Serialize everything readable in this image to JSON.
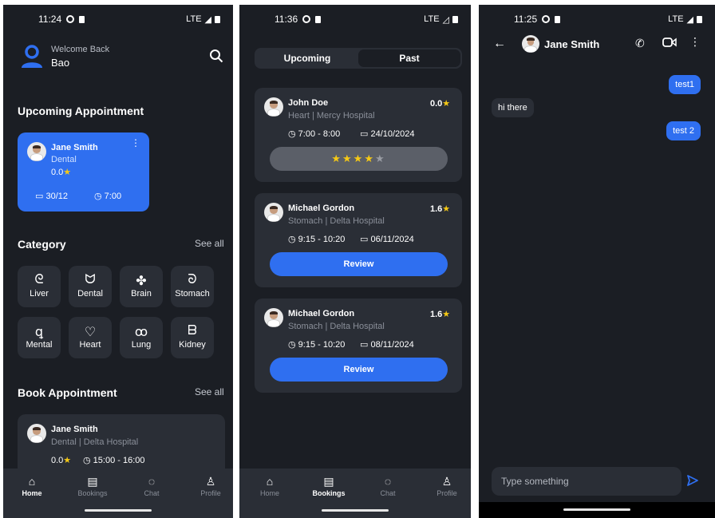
{
  "home": {
    "status": {
      "time": "11:24",
      "network": "LTE"
    },
    "welcome": "Welcome Back",
    "user_name": "Bao",
    "upcoming_title": "Upcoming Appointment",
    "upcoming": {
      "doctor": "Jane Smith",
      "specialty": "Dental",
      "rating": "0.0",
      "date": "30/12",
      "time": "7:00"
    },
    "category_title": "Category",
    "see_all": "See all",
    "categories": [
      "Liver",
      "Dental",
      "Brain",
      "Stomach",
      "Mental",
      "Heart",
      "Lung",
      "Kidney"
    ],
    "book_title": "Book Appointment",
    "book": {
      "doctor": "Jane Smith",
      "detail": "Dental | Delta Hospital",
      "rating": "0.0",
      "time": "15:00 - 16:00"
    },
    "nav": [
      "Home",
      "Bookings",
      "Chat",
      "Profile"
    ]
  },
  "bookings": {
    "status": {
      "time": "11:36",
      "network": "LTE"
    },
    "tabs": [
      "Upcoming",
      "Past"
    ],
    "cards": [
      {
        "doctor": "John Doe",
        "detail": "Heart | Mercy Hospital",
        "rating": "0.0",
        "time": "7:00 - 8:00",
        "date": "24/10/2024",
        "stars": 4
      },
      {
        "doctor": "Michael Gordon",
        "detail": "Stomach | Delta Hospital",
        "rating": "1.6",
        "time": "9:15 - 10:20",
        "date": "06/11/2024",
        "button": "Review"
      },
      {
        "doctor": "Michael Gordon",
        "detail": "Stomach | Delta Hospital",
        "rating": "1.6",
        "time": "9:15 - 10:20",
        "date": "08/11/2024",
        "button": "Review"
      }
    ],
    "nav": [
      "Home",
      "Bookings",
      "Chat",
      "Profile"
    ]
  },
  "chat": {
    "status": {
      "time": "11:25",
      "network": "LTE"
    },
    "contact": "Jane Smith",
    "messages": [
      {
        "from": "me",
        "text": "test1"
      },
      {
        "from": "them",
        "text": "hi there"
      },
      {
        "from": "me",
        "text": "test 2"
      }
    ],
    "input_placeholder": "Type something"
  },
  "colors": {
    "background": "#1b1e24",
    "card": "#2a2e36",
    "accent": "#2f6ff0",
    "star": "#f6c915"
  }
}
